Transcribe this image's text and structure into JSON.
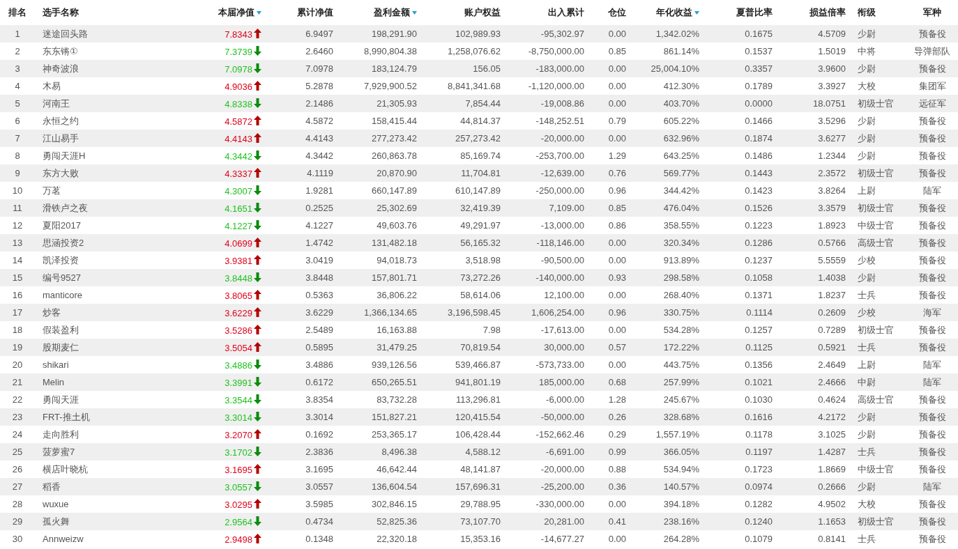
{
  "table": {
    "columns": [
      {
        "label": "排名",
        "sorted": false
      },
      {
        "label": "选手名称",
        "sorted": false
      },
      {
        "label": "本届净值",
        "sorted": true
      },
      {
        "label": "累计净值",
        "sorted": false
      },
      {
        "label": "盈利金额",
        "sorted": true
      },
      {
        "label": "账户权益",
        "sorted": false
      },
      {
        "label": "出入累计",
        "sorted": false
      },
      {
        "label": "仓位",
        "sorted": false
      },
      {
        "label": "年化收益",
        "sorted": true
      },
      {
        "label": "夏普比率",
        "sorted": false
      },
      {
        "label": "损益倍率",
        "sorted": false
      },
      {
        "label": "衔级",
        "sorted": false
      },
      {
        "label": "军种",
        "sorted": false
      }
    ],
    "rows": [
      {
        "kind": "up",
        "cells": [
          "1",
          "迷途回头路",
          "7.8343",
          "6.9497",
          "198,291.90",
          "102,989.93",
          "-95,302.97",
          "0.00",
          "1,342.02%",
          "0.1675",
          "4.5709",
          "少尉",
          "预备役"
        ]
      },
      {
        "kind": "down",
        "cells": [
          "2",
          "东东锵①",
          "7.3739",
          "2.6460",
          "8,990,804.38",
          "1,258,076.62",
          "-8,750,000.00",
          "0.85",
          "861.14%",
          "0.1537",
          "1.5019",
          "中将",
          "导弹部队"
        ]
      },
      {
        "kind": "down",
        "cells": [
          "3",
          "神奇波浪",
          "7.0978",
          "7.0978",
          "183,124.79",
          "156.05",
          "-183,000.00",
          "0.00",
          "25,004.10%",
          "0.3357",
          "3.9600",
          "少尉",
          "预备役"
        ]
      },
      {
        "kind": "up",
        "cells": [
          "4",
          "木易",
          "4.9036",
          "5.2878",
          "7,929,900.52",
          "8,841,341.68",
          "-1,120,000.00",
          "0.00",
          "412.30%",
          "0.1789",
          "3.3927",
          "大校",
          "集团军"
        ]
      },
      {
        "kind": "down",
        "cells": [
          "5",
          "河南王",
          "4.8338",
          "2.1486",
          "21,305.93",
          "7,854.44",
          "-19,008.86",
          "0.00",
          "403.70%",
          "0.0000",
          "18.0751",
          "初级士官",
          "远征军"
        ]
      },
      {
        "kind": "up",
        "cells": [
          "6",
          "永恒之约",
          "4.5872",
          "4.5872",
          "158,415.44",
          "44,814.37",
          "-148,252.51",
          "0.79",
          "605.22%",
          "0.1466",
          "3.5296",
          "少尉",
          "预备役"
        ]
      },
      {
        "kind": "up",
        "cells": [
          "7",
          "江山易手",
          "4.4143",
          "4.4143",
          "277,273.42",
          "257,273.42",
          "-20,000.00",
          "0.00",
          "632.96%",
          "0.1874",
          "3.6277",
          "少尉",
          "预备役"
        ]
      },
      {
        "kind": "down",
        "cells": [
          "8",
          "勇闯天涯H",
          "4.3442",
          "4.3442",
          "260,863.78",
          "85,169.74",
          "-253,700.00",
          "1.29",
          "643.25%",
          "0.1486",
          "1.2344",
          "少尉",
          "预备役"
        ]
      },
      {
        "kind": "up",
        "cells": [
          "9",
          "东方大败",
          "4.3337",
          "4.1119",
          "20,870.90",
          "11,704.81",
          "-12,639.00",
          "0.76",
          "569.77%",
          "0.1443",
          "2.3572",
          "初级士官",
          "预备役"
        ]
      },
      {
        "kind": "down",
        "cells": [
          "10",
          "万茗",
          "4.3007",
          "1.9281",
          "660,147.89",
          "610,147.89",
          "-250,000.00",
          "0.96",
          "344.42%",
          "0.1423",
          "3.8264",
          "上尉",
          "陆军"
        ]
      },
      {
        "kind": "down",
        "cells": [
          "11",
          "滑铁卢之夜",
          "4.1651",
          "0.2525",
          "25,302.69",
          "32,419.39",
          "7,109.00",
          "0.85",
          "476.04%",
          "0.1526",
          "3.3579",
          "初级士官",
          "预备役"
        ]
      },
      {
        "kind": "down",
        "cells": [
          "12",
          "夏阳2017",
          "4.1227",
          "4.1227",
          "49,603.76",
          "49,291.97",
          "-13,000.00",
          "0.86",
          "358.55%",
          "0.1223",
          "1.8923",
          "中级士官",
          "预备役"
        ]
      },
      {
        "kind": "up",
        "cells": [
          "13",
          "思涵投资2",
          "4.0699",
          "1.4742",
          "131,482.18",
          "56,165.32",
          "-118,146.00",
          "0.00",
          "320.34%",
          "0.1286",
          "0.5766",
          "高级士官",
          "预备役"
        ]
      },
      {
        "kind": "up",
        "cells": [
          "14",
          "凯泽投资",
          "3.9381",
          "3.0419",
          "94,018.73",
          "3,518.98",
          "-90,500.00",
          "0.00",
          "913.89%",
          "0.1237",
          "5.5559",
          "少校",
          "预备役"
        ]
      },
      {
        "kind": "down",
        "cells": [
          "15",
          "编号9527",
          "3.8448",
          "3.8448",
          "157,801.71",
          "73,272.26",
          "-140,000.00",
          "0.93",
          "298.58%",
          "0.1058",
          "1.4038",
          "少尉",
          "预备役"
        ]
      },
      {
        "kind": "up",
        "cells": [
          "16",
          "manticore",
          "3.8065",
          "0.5363",
          "36,806.22",
          "58,614.06",
          "12,100.00",
          "0.00",
          "268.40%",
          "0.1371",
          "1.8237",
          "士兵",
          "预备役"
        ]
      },
      {
        "kind": "up",
        "cells": [
          "17",
          "炒客",
          "3.6229",
          "3.6229",
          "1,366,134.65",
          "3,196,598.45",
          "1,606,254.00",
          "0.96",
          "330.75%",
          "0.1114",
          "0.2609",
          "少校",
          "海军"
        ]
      },
      {
        "kind": "up",
        "cells": [
          "18",
          "假装盈利",
          "3.5286",
          "2.5489",
          "16,163.88",
          "7.98",
          "-17,613.00",
          "0.00",
          "534.28%",
          "0.1257",
          "0.7289",
          "初级士官",
          "预备役"
        ]
      },
      {
        "kind": "up",
        "cells": [
          "19",
          "股期麦仁",
          "3.5054",
          "0.5895",
          "31,479.25",
          "70,819.54",
          "30,000.00",
          "0.57",
          "172.22%",
          "0.1125",
          "0.5921",
          "士兵",
          "预备役"
        ]
      },
      {
        "kind": "down",
        "cells": [
          "20",
          "shikari",
          "3.4886",
          "3.4886",
          "939,126.56",
          "539,466.87",
          "-573,733.00",
          "0.00",
          "443.75%",
          "0.1356",
          "2.4649",
          "上尉",
          "陆军"
        ]
      },
      {
        "kind": "down",
        "cells": [
          "21",
          "Melin",
          "3.3991",
          "0.6172",
          "650,265.51",
          "941,801.19",
          "185,000.00",
          "0.68",
          "257.99%",
          "0.1021",
          "2.4666",
          "中尉",
          "陆军"
        ]
      },
      {
        "kind": "down",
        "cells": [
          "22",
          "勇闯天涯",
          "3.3544",
          "3.8354",
          "83,732.28",
          "113,296.81",
          "-6,000.00",
          "1.28",
          "245.67%",
          "0.1030",
          "0.4624",
          "高级士官",
          "预备役"
        ]
      },
      {
        "kind": "down",
        "cells": [
          "23",
          "FRT-推土机",
          "3.3014",
          "3.3014",
          "151,827.21",
          "120,415.54",
          "-50,000.00",
          "0.26",
          "328.68%",
          "0.1616",
          "4.2172",
          "少尉",
          "预备役"
        ]
      },
      {
        "kind": "up",
        "cells": [
          "24",
          "走向胜利",
          "3.2070",
          "0.1692",
          "253,365.17",
          "106,428.44",
          "-152,662.46",
          "0.29",
          "1,557.19%",
          "0.1178",
          "3.1025",
          "少尉",
          "预备役"
        ]
      },
      {
        "kind": "down",
        "cells": [
          "25",
          "菠萝蜜7",
          "3.1702",
          "2.3836",
          "8,496.38",
          "4,588.12",
          "-6,691.00",
          "0.99",
          "366.05%",
          "0.1197",
          "1.4287",
          "士兵",
          "预备役"
        ]
      },
      {
        "kind": "up",
        "cells": [
          "26",
          "横店叶晓杭",
          "3.1695",
          "3.1695",
          "46,642.44",
          "48,141.87",
          "-20,000.00",
          "0.88",
          "534.94%",
          "0.1723",
          "1.8669",
          "中级士官",
          "预备役"
        ]
      },
      {
        "kind": "down",
        "cells": [
          "27",
          "稻香",
          "3.0557",
          "3.0557",
          "136,604.54",
          "157,696.31",
          "-25,200.00",
          "0.36",
          "140.57%",
          "0.0974",
          "0.2666",
          "少尉",
          "陆军"
        ]
      },
      {
        "kind": "up",
        "cells": [
          "28",
          "wuxue",
          "3.0295",
          "3.5985",
          "302,846.15",
          "29,788.95",
          "-330,000.00",
          "0.00",
          "394.18%",
          "0.1282",
          "4.9502",
          "大校",
          "预备役"
        ]
      },
      {
        "kind": "down",
        "cells": [
          "29",
          "孤火舞",
          "2.9564",
          "0.4734",
          "52,825.36",
          "73,107.70",
          "20,281.00",
          "0.41",
          "238.16%",
          "0.1240",
          "1.1653",
          "初级士官",
          "预备役"
        ]
      },
      {
        "kind": "up",
        "cells": [
          "30",
          "Annweizw",
          "2.9498",
          "0.1348",
          "22,320.18",
          "15,353.16",
          "-14,677.27",
          "0.00",
          "264.28%",
          "0.1079",
          "0.8141",
          "士兵",
          "预备役"
        ]
      }
    ]
  }
}
